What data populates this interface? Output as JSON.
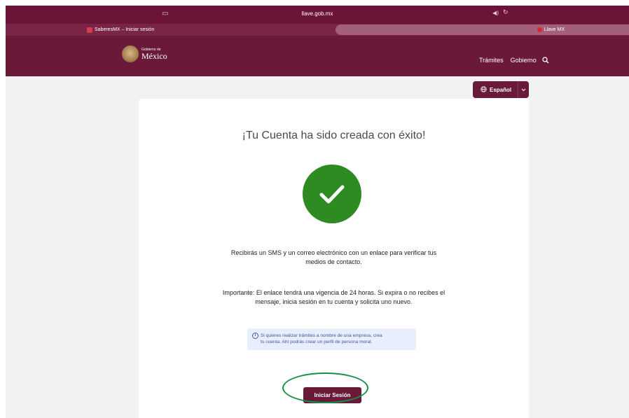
{
  "browser": {
    "url": "llave.gob.mx",
    "tabs": [
      {
        "label": "SaberesMX – Iniciar sesión"
      },
      {
        "label": "Llave MX"
      }
    ]
  },
  "header": {
    "logo_small": "Gobierno de",
    "logo_big": "México",
    "nav": [
      {
        "label": "Trámites"
      },
      {
        "label": "Gobierno"
      }
    ]
  },
  "language": {
    "label": "Español"
  },
  "card": {
    "title": "¡Tu Cuenta ha sido creada con éxito!",
    "message_1_line_1": "Recibirás un SMS y un correo electrónico con un enlace para verificar tus",
    "message_1_line_2": "medios de contacto.",
    "message_2_line_1": "Importante: El enlace tendrá una vigencia de 24 horas. Si expira o no recibes el",
    "message_2_line_2": "mensaje, inicia sesión en tu cuenta y solicita uno nuevo.",
    "info_line_1": "Si quieres realizar trámites a nombre de una empresa, crea",
    "info_line_2": "tu cuenta. Ahí podrás crear un perfil de persona moral.",
    "button_label": "Iniciar Sesión"
  },
  "colors": {
    "brand": "#6a1a38",
    "success": "#2e8b22",
    "highlight": "#139146",
    "info": "#3d57a8"
  }
}
